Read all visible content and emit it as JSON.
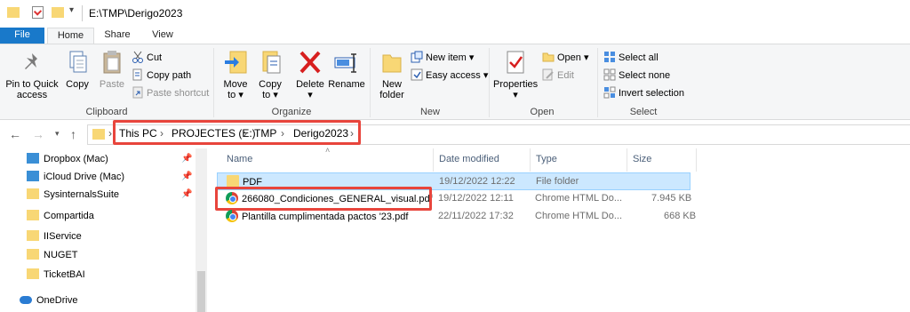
{
  "window": {
    "title": "E:\\TMP\\Derigo2023"
  },
  "tabs": {
    "file": "File",
    "home": "Home",
    "share": "Share",
    "view": "View"
  },
  "ribbon": {
    "clipboard": {
      "pin_line1": "Pin to Quick",
      "pin_line2": "access",
      "copy": "Copy",
      "paste": "Paste",
      "cut": "Cut",
      "copy_path": "Copy path",
      "paste_shortcut": "Paste shortcut",
      "label": "Clipboard"
    },
    "organize": {
      "move_line1": "Move",
      "move_line2": "to",
      "copy_line1": "Copy",
      "copy_line2": "to",
      "delete": "Delete",
      "rename": "Rename",
      "label": "Organize"
    },
    "new": {
      "folder_line1": "New",
      "folder_line2": "folder",
      "new_item": "New item",
      "easy_access": "Easy access",
      "label": "New"
    },
    "open": {
      "properties": "Properties",
      "open": "Open",
      "edit": "Edit",
      "label": "Open"
    },
    "select": {
      "select_all": "Select all",
      "select_none": "Select none",
      "invert": "Invert selection",
      "label": "Select"
    }
  },
  "address": {
    "crumbs": [
      "This PC",
      "PROJECTES (E:)",
      "TMP",
      "Derigo2023"
    ]
  },
  "nav": {
    "items": [
      {
        "label": "Dropbox (Mac)",
        "pinned": true
      },
      {
        "label": "iCloud Drive (Mac)",
        "pinned": true
      },
      {
        "label": "SysinternalsSuite",
        "pinned": true
      },
      {
        "label": "Compartida",
        "pinned": false
      },
      {
        "label": "IIService",
        "pinned": false
      },
      {
        "label": "NUGET",
        "pinned": false
      },
      {
        "label": "TicketBAI",
        "pinned": false
      },
      {
        "label": "OneDrive",
        "pinned": false
      }
    ]
  },
  "files": {
    "columns": {
      "name": "Name",
      "date": "Date modified",
      "type": "Type",
      "size": "Size"
    },
    "rows": [
      {
        "name": "PDF",
        "date": "19/12/2022 12:22",
        "type": "File folder",
        "size": "",
        "icon": "folder-icon"
      },
      {
        "name": "266080_Condiciones_GENERAL_visual.pdf",
        "date": "19/12/2022 12:11",
        "type": "Chrome HTML Do...",
        "size": "7.945 KB",
        "icon": "chrome-icon"
      },
      {
        "name": "Plantilla cumplimentada pactos '23.pdf",
        "date": "22/11/2022 17:32",
        "type": "Chrome HTML Do...",
        "size": "668 KB",
        "icon": "chrome-icon"
      }
    ]
  },
  "colors": {
    "accent": "#1979ca",
    "highlight": "#e8453c",
    "selection": "#cce8ff"
  }
}
